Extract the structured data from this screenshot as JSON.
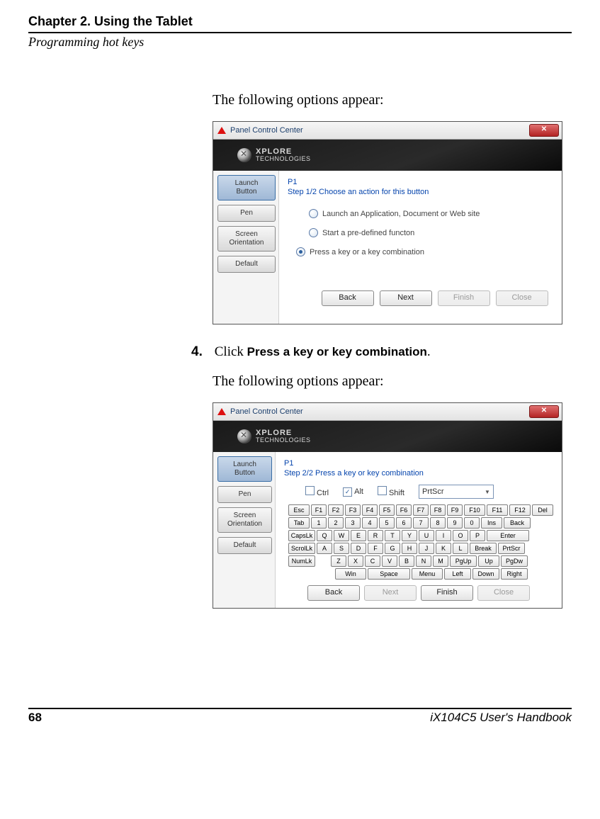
{
  "header": {
    "chapter": "Chapter 2. Using the Tablet",
    "section": "Programming hot keys"
  },
  "text": {
    "intro1": "The following options appear:",
    "step4_num": "4.",
    "step4_a": "Click ",
    "step4_b": "Press a key or key combination",
    "step4_c": ".",
    "intro2": "The following options appear:"
  },
  "dialog_common": {
    "title": "Panel Control Center",
    "close_glyph": "✕",
    "brand_top": "XPLORE",
    "brand_bottom": "TECHNOLOGIES",
    "side": {
      "launch": "Launch\nButton",
      "pen": "Pen",
      "screen": "Screen\nOrientation",
      "default": "Default"
    },
    "btn_back": "Back",
    "btn_next": "Next",
    "btn_finish": "Finish",
    "btn_close": "Close"
  },
  "dialog1": {
    "p": "P1",
    "step": "Step 1/2     Choose an action for this button",
    "opt1": "Launch an Application, Document or Web site",
    "opt2": "Start a pre-defined functon",
    "opt3": "Press a key or a key combination"
  },
  "dialog2": {
    "p": "P1",
    "step": "Step 2/2     Press a key or key combination",
    "mod_ctrl": "Ctrl",
    "mod_alt": "Alt",
    "mod_shift": "Shift",
    "combo": "PrtScr",
    "keys": {
      "r1": [
        "Esc",
        "F1",
        "F2",
        "F3",
        "F4",
        "F5",
        "F6",
        "F7",
        "F8",
        "F9",
        "F10",
        "F11",
        "F12",
        "Del"
      ],
      "r2": [
        "Tab",
        "1",
        "2",
        "3",
        "4",
        "5",
        "6",
        "7",
        "8",
        "9",
        "0",
        "Ins",
        "Back"
      ],
      "r3": [
        "CapsLk",
        "Q",
        "W",
        "E",
        "R",
        "T",
        "Y",
        "U",
        "I",
        "O",
        "P",
        "Enter"
      ],
      "r4": [
        "ScrolLk",
        "A",
        "S",
        "D",
        "F",
        "G",
        "H",
        "J",
        "K",
        "L",
        "Break",
        "PrtScr"
      ],
      "r5": [
        "NumLk",
        "Z",
        "X",
        "C",
        "V",
        "B",
        "N",
        "M",
        "PgUp",
        "Up",
        "PgDw"
      ],
      "r6": [
        "Win",
        "Space",
        "Menu",
        "Left",
        "Down",
        "Right"
      ]
    }
  },
  "chart_data": null,
  "footer": {
    "page": "68",
    "book": "iX104C5 User's Handbook"
  }
}
